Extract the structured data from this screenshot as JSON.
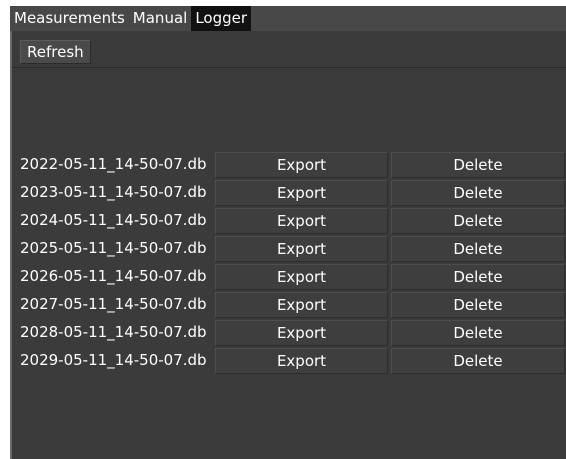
{
  "tabs": [
    {
      "label": "Measurements",
      "active": false
    },
    {
      "label": "Manual",
      "active": false
    },
    {
      "label": "Logger",
      "active": true
    }
  ],
  "toolbar": {
    "refresh_label": "Refresh"
  },
  "files": [
    {
      "name": "2022-05-11_14-50-07.db",
      "export_label": "Export",
      "delete_label": "Delete"
    },
    {
      "name": "2023-05-11_14-50-07.db",
      "export_label": "Export",
      "delete_label": "Delete"
    },
    {
      "name": "2024-05-11_14-50-07.db",
      "export_label": "Export",
      "delete_label": "Delete"
    },
    {
      "name": "2025-05-11_14-50-07.db",
      "export_label": "Export",
      "delete_label": "Delete"
    },
    {
      "name": "2026-05-11_14-50-07.db",
      "export_label": "Export",
      "delete_label": "Delete"
    },
    {
      "name": "2027-05-11_14-50-07.db",
      "export_label": "Export",
      "delete_label": "Delete"
    },
    {
      "name": "2028-05-11_14-50-07.db",
      "export_label": "Export",
      "delete_label": "Delete"
    },
    {
      "name": "2029-05-11_14-50-07.db",
      "export_label": "Export",
      "delete_label": "Delete"
    }
  ],
  "colors": {
    "window_background": "#484848",
    "panel_background": "#3b3b3b",
    "active_tab_background": "#111111",
    "text": "#ffffff"
  }
}
